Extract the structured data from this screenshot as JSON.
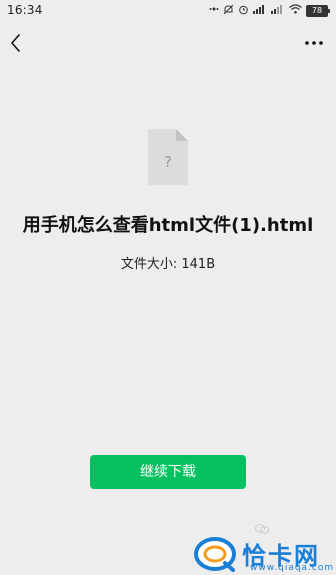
{
  "status_bar": {
    "time": "16:34",
    "battery_level": "78",
    "icons": [
      "notification-icon",
      "mute-icon",
      "alarm-icon",
      "signal-icon",
      "signal-icon",
      "wifi-icon",
      "battery-icon"
    ]
  },
  "nav": {
    "back_icon": "chevron-left-icon",
    "more_icon": "more-horizontal-icon"
  },
  "file": {
    "icon": "unknown-file-icon",
    "icon_glyph": "?",
    "name": "用手机怎么查看html文件(1).html",
    "size_text": "文件大小: 141B"
  },
  "actions": {
    "download_label": "继续下载",
    "download_color": "#07c160"
  },
  "watermark": {
    "text": "恰卡网",
    "url": "www.qiaqa.com",
    "color": "#1a7fd6"
  }
}
